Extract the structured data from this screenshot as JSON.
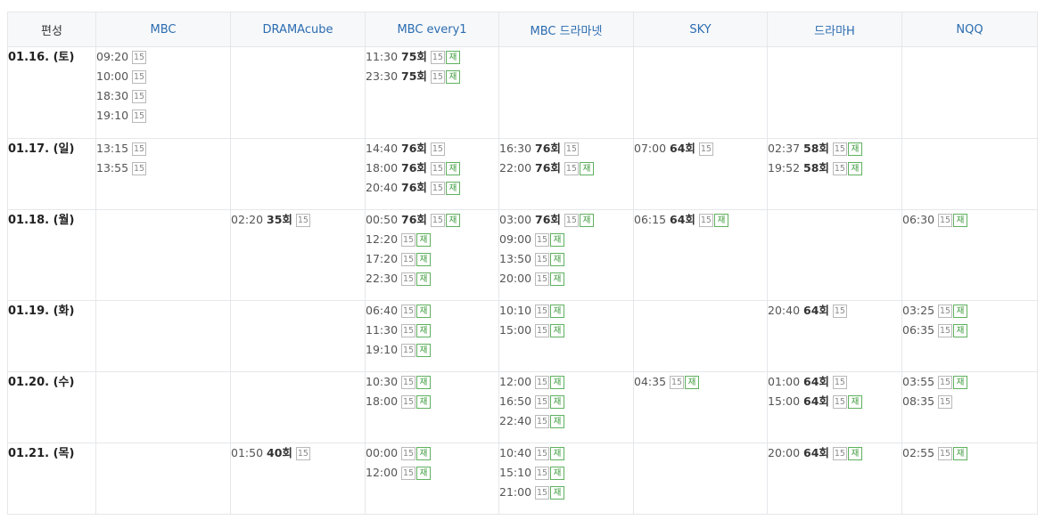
{
  "header": {
    "date_col": "편성",
    "channels": [
      "MBC",
      "DRAMAcube",
      "MBC every1",
      "MBC 드라마넷",
      "SKY",
      "드라마H",
      "NQQ"
    ]
  },
  "rows": [
    {
      "date": "01.16. (토)",
      "cells": [
        [
          {
            "time": "09:20",
            "ep": "",
            "rating": "15",
            "rerun": ""
          },
          {
            "time": "10:00",
            "ep": "",
            "rating": "15",
            "rerun": ""
          },
          {
            "time": "18:30",
            "ep": "",
            "rating": "15",
            "rerun": ""
          },
          {
            "time": "19:10",
            "ep": "",
            "rating": "15",
            "rerun": ""
          }
        ],
        [],
        [
          {
            "time": "11:30",
            "ep": "75회",
            "rating": "15",
            "rerun": "재"
          },
          {
            "time": "23:30",
            "ep": "75회",
            "rating": "15",
            "rerun": "재"
          }
        ],
        [],
        [],
        [],
        []
      ]
    },
    {
      "date": "01.17. (일)",
      "cells": [
        [
          {
            "time": "13:15",
            "ep": "",
            "rating": "15",
            "rerun": ""
          },
          {
            "time": "13:55",
            "ep": "",
            "rating": "15",
            "rerun": ""
          }
        ],
        [],
        [
          {
            "time": "14:40",
            "ep": "76회",
            "rating": "15",
            "rerun": ""
          },
          {
            "time": "18:00",
            "ep": "76회",
            "rating": "15",
            "rerun": "재"
          },
          {
            "time": "20:40",
            "ep": "76회",
            "rating": "15",
            "rerun": "재"
          }
        ],
        [
          {
            "time": "16:30",
            "ep": "76회",
            "rating": "15",
            "rerun": ""
          },
          {
            "time": "22:00",
            "ep": "76회",
            "rating": "15",
            "rerun": "재"
          }
        ],
        [
          {
            "time": "07:00",
            "ep": "64회",
            "rating": "15",
            "rerun": ""
          }
        ],
        [
          {
            "time": "02:37",
            "ep": "58회",
            "rating": "15",
            "rerun": "재"
          },
          {
            "time": "19:52",
            "ep": "58회",
            "rating": "15",
            "rerun": "재"
          }
        ],
        []
      ]
    },
    {
      "date": "01.18. (월)",
      "cells": [
        [],
        [
          {
            "time": "02:20",
            "ep": "35회",
            "rating": "15",
            "rerun": ""
          }
        ],
        [
          {
            "time": "00:50",
            "ep": "76회",
            "rating": "15",
            "rerun": "재"
          },
          {
            "time": "12:20",
            "ep": "",
            "rating": "15",
            "rerun": "재"
          },
          {
            "time": "17:20",
            "ep": "",
            "rating": "15",
            "rerun": "재"
          },
          {
            "time": "22:30",
            "ep": "",
            "rating": "15",
            "rerun": "재"
          }
        ],
        [
          {
            "time": "03:00",
            "ep": "76회",
            "rating": "15",
            "rerun": "재"
          },
          {
            "time": "09:00",
            "ep": "",
            "rating": "15",
            "rerun": "재"
          },
          {
            "time": "13:50",
            "ep": "",
            "rating": "15",
            "rerun": "재"
          },
          {
            "time": "20:00",
            "ep": "",
            "rating": "15",
            "rerun": "재"
          }
        ],
        [
          {
            "time": "06:15",
            "ep": "64회",
            "rating": "15",
            "rerun": "재"
          }
        ],
        [],
        [
          {
            "time": "06:30",
            "ep": "",
            "rating": "15",
            "rerun": "재"
          }
        ]
      ]
    },
    {
      "date": "01.19. (화)",
      "cells": [
        [],
        [],
        [
          {
            "time": "06:40",
            "ep": "",
            "rating": "15",
            "rerun": "재"
          },
          {
            "time": "11:30",
            "ep": "",
            "rating": "15",
            "rerun": "재"
          },
          {
            "time": "19:10",
            "ep": "",
            "rating": "15",
            "rerun": "재"
          }
        ],
        [
          {
            "time": "10:10",
            "ep": "",
            "rating": "15",
            "rerun": "재"
          },
          {
            "time": "15:00",
            "ep": "",
            "rating": "15",
            "rerun": "재"
          }
        ],
        [],
        [
          {
            "time": "20:40",
            "ep": "64회",
            "rating": "15",
            "rerun": ""
          }
        ],
        [
          {
            "time": "03:25",
            "ep": "",
            "rating": "15",
            "rerun": "재"
          },
          {
            "time": "06:35",
            "ep": "",
            "rating": "15",
            "rerun": "재"
          }
        ]
      ]
    },
    {
      "date": "01.20. (수)",
      "cells": [
        [],
        [],
        [
          {
            "time": "10:30",
            "ep": "",
            "rating": "15",
            "rerun": "재"
          },
          {
            "time": "18:00",
            "ep": "",
            "rating": "15",
            "rerun": "재"
          }
        ],
        [
          {
            "time": "12:00",
            "ep": "",
            "rating": "15",
            "rerun": "재"
          },
          {
            "time": "16:50",
            "ep": "",
            "rating": "15",
            "rerun": "재"
          },
          {
            "time": "22:40",
            "ep": "",
            "rating": "15",
            "rerun": "재"
          }
        ],
        [
          {
            "time": "04:35",
            "ep": "",
            "rating": "15",
            "rerun": "재"
          }
        ],
        [
          {
            "time": "01:00",
            "ep": "64회",
            "rating": "15",
            "rerun": ""
          },
          {
            "time": "15:00",
            "ep": "64회",
            "rating": "15",
            "rerun": "재"
          }
        ],
        [
          {
            "time": "03:55",
            "ep": "",
            "rating": "15",
            "rerun": "재"
          },
          {
            "time": "08:35",
            "ep": "",
            "rating": "15",
            "rerun": ""
          }
        ]
      ]
    },
    {
      "date": "01.21. (목)",
      "cells": [
        [],
        [
          {
            "time": "01:50",
            "ep": "40회",
            "rating": "15",
            "rerun": ""
          }
        ],
        [
          {
            "time": "00:00",
            "ep": "",
            "rating": "15",
            "rerun": "재"
          },
          {
            "time": "12:00",
            "ep": "",
            "rating": "15",
            "rerun": "재"
          }
        ],
        [
          {
            "time": "10:40",
            "ep": "",
            "rating": "15",
            "rerun": "재"
          },
          {
            "time": "15:10",
            "ep": "",
            "rating": "15",
            "rerun": "재"
          },
          {
            "time": "21:00",
            "ep": "",
            "rating": "15",
            "rerun": "재"
          }
        ],
        [],
        [
          {
            "time": "20:00",
            "ep": "64회",
            "rating": "15",
            "rerun": "재"
          }
        ],
        [
          {
            "time": "02:55",
            "ep": "",
            "rating": "15",
            "rerun": "재"
          }
        ]
      ]
    }
  ]
}
